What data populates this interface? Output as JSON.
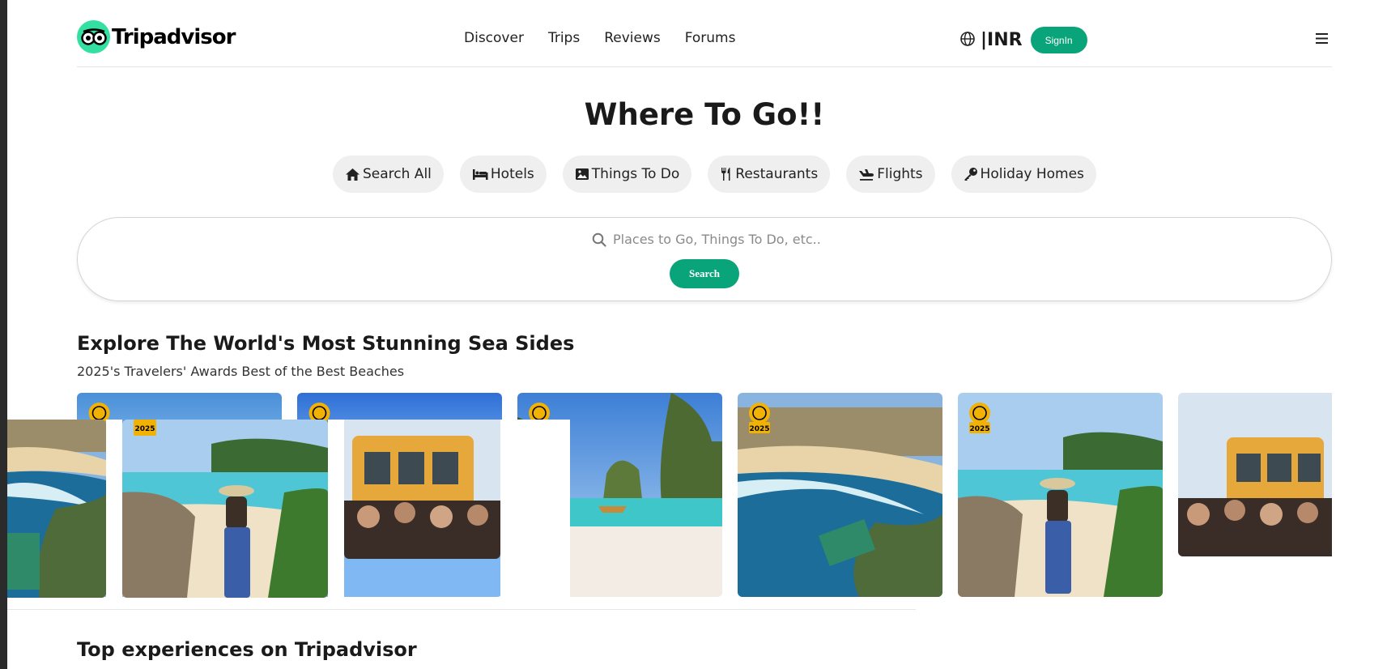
{
  "header": {
    "logo_text": "Tripadvisor",
    "nav": [
      "Discover",
      "Trips",
      "Reviews",
      "Forums"
    ],
    "currency": "|INR",
    "signin_label": "SignIn"
  },
  "hero": {
    "title": "Where To Go!!",
    "categories": [
      "Search All",
      "Hotels",
      "Things To Do",
      "Restaurants",
      "Flights",
      "Holiday Homes"
    ],
    "search_placeholder": "Places to Go, Things To Do, etc..",
    "search_button": "Search"
  },
  "beaches": {
    "title": "Explore The World's Most Stunning Sea Sides",
    "subtitle": "2025's Travelers' Awards Best of the Best Beaches",
    "badge_year": "2025"
  },
  "experiences": {
    "title": "Top experiences on Tripadvisor"
  },
  "colors": {
    "brand_green": "#34e0a1",
    "button_green": "#0aa47a",
    "badge_yellow": "#f2b203"
  }
}
